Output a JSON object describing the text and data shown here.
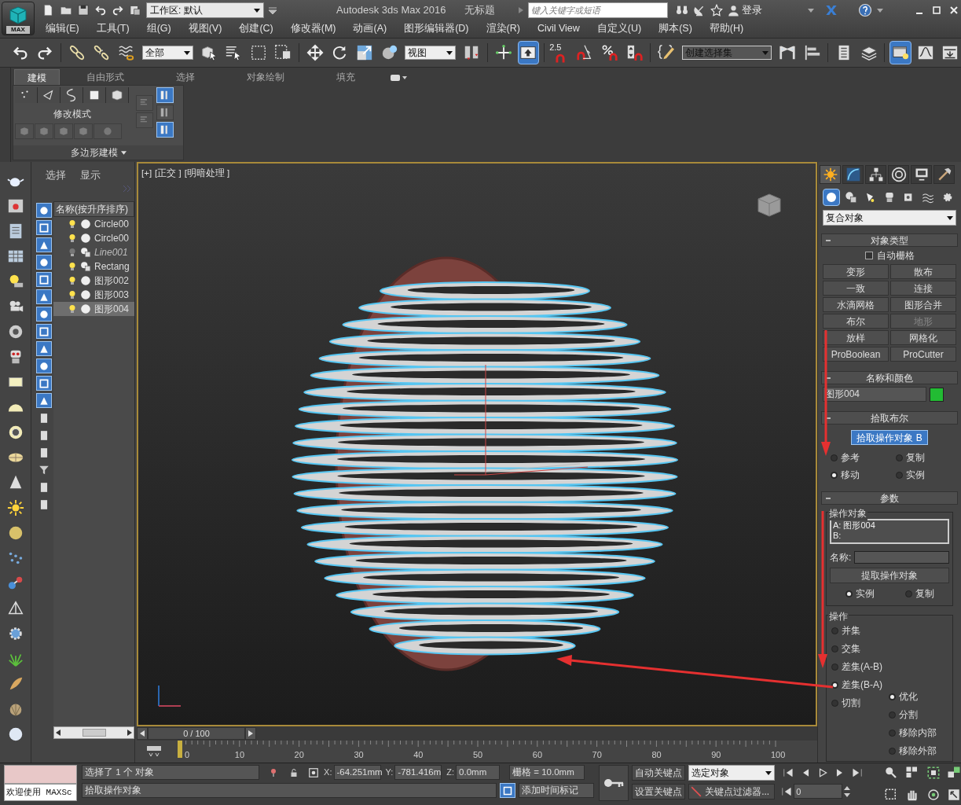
{
  "title_bar": {
    "app_button": "MAX",
    "workspace": "工作区: 默认",
    "app_name": "Autodesk 3ds Max 2016",
    "document": "无标题",
    "search": {
      "placeholder": "键入关键字或短语"
    },
    "sign_in": "登录"
  },
  "menu": [
    "编辑(E)",
    "工具(T)",
    "组(G)",
    "视图(V)",
    "创建(C)",
    "修改器(M)",
    "动画(A)",
    "图形编辑器(D)",
    "渲染(R)",
    "Civil View",
    "自定义(U)",
    "脚本(S)",
    "帮助(H)"
  ],
  "toolbar": [
    {
      "kind": "button",
      "active": false
    },
    {
      "kind": "button",
      "active": false
    },
    {
      "kind": "sep"
    },
    {
      "kind": "button",
      "active": false
    },
    {
      "kind": "button",
      "active": false
    },
    {
      "kind": "button",
      "active": false
    },
    {
      "kind": "dropdown",
      "value": "全部"
    },
    {
      "kind": "button",
      "active": false
    },
    {
      "kind": "button",
      "active": false
    },
    {
      "kind": "button",
      "active": false
    },
    {
      "kind": "button",
      "active": false
    },
    {
      "kind": "sep"
    },
    {
      "kind": "button",
      "active": false
    },
    {
      "kind": "button",
      "active": false
    },
    {
      "kind": "button",
      "active": false
    },
    {
      "kind": "button",
      "active": false
    },
    {
      "kind": "dropdown",
      "value": "视图"
    },
    {
      "kind": "button",
      "active": false
    },
    {
      "kind": "sep"
    },
    {
      "kind": "button",
      "active": false
    },
    {
      "kind": "button",
      "active": true
    },
    {
      "kind": "sep"
    },
    {
      "kind": "snap",
      "label": "2.5",
      "active": false
    },
    {
      "kind": "button",
      "active": false
    },
    {
      "kind": "button",
      "active": false
    },
    {
      "kind": "button",
      "active": false
    },
    {
      "kind": "sep"
    },
    {
      "kind": "button",
      "active": false
    },
    {
      "kind": "dropdown",
      "value": "创建选择集"
    },
    {
      "kind": "button",
      "active": false
    },
    {
      "kind": "button",
      "active": false
    },
    {
      "kind": "sep"
    },
    {
      "kind": "button",
      "active": false
    },
    {
      "kind": "button",
      "active": false
    },
    {
      "kind": "sep"
    },
    {
      "kind": "button",
      "active": true
    },
    {
      "kind": "button",
      "active": false
    },
    {
      "kind": "button",
      "active": false
    }
  ],
  "ribbon": {
    "tabs": [
      {
        "label": "建模",
        "selected": true
      },
      {
        "label": "自由形式",
        "selected": false
      },
      {
        "label": "选择",
        "selected": false
      },
      {
        "label": "对象绘制",
        "selected": false
      },
      {
        "label": "填充",
        "selected": false
      }
    ],
    "panel_label": "修改模式",
    "footer": "多边形建模",
    "side_buttons": [
      {
        "active": true
      },
      {
        "active": false
      },
      {
        "active": true
      }
    ]
  },
  "scene_explorer": {
    "tabs": [
      "选择",
      "显示"
    ],
    "column": "名称(按升序排序)",
    "rows": [
      {
        "name": "Circle00",
        "hidden": false,
        "selected": false
      },
      {
        "name": "Circle00",
        "hidden": false,
        "selected": false
      },
      {
        "name": "Line001",
        "hidden": true,
        "selected": false
      },
      {
        "name": "Rectang",
        "hidden": false,
        "selected": false
      },
      {
        "name": "图形002",
        "hidden": false,
        "selected": false
      },
      {
        "name": "图形003",
        "hidden": false,
        "selected": false
      },
      {
        "name": "图形004",
        "hidden": false,
        "selected": true
      }
    ]
  },
  "viewport": {
    "labels": [
      "[+]",
      "[正交 ]",
      "[明暗处理 ]"
    ]
  },
  "command_panel": {
    "tabs": [
      {
        "selected": true
      },
      {
        "selected": false
      },
      {
        "selected": false
      },
      {
        "selected": false
      },
      {
        "selected": false
      },
      {
        "selected": false
      }
    ],
    "categories": [
      {
        "selected": true
      },
      {
        "selected": false
      },
      {
        "selected": false
      },
      {
        "selected": false
      },
      {
        "selected": false
      },
      {
        "selected": false
      },
      {
        "selected": false
      }
    ],
    "category": "复合对象",
    "object_type": {
      "title": "对象类型",
      "auto_grid": {
        "label": "自动栅格",
        "checked": false
      },
      "buttons": [
        {
          "label": "变形",
          "disabled": false
        },
        {
          "label": "散布",
          "disabled": false
        },
        {
          "label": "一致",
          "disabled": false
        },
        {
          "label": "连接",
          "disabled": false
        },
        {
          "label": "水滴网格",
          "disabled": false
        },
        {
          "label": "图形合并",
          "disabled": false
        },
        {
          "label": "布尔",
          "disabled": false
        },
        {
          "label": "地形",
          "disabled": true
        },
        {
          "label": "放样",
          "disabled": false
        },
        {
          "label": "网格化",
          "disabled": false
        },
        {
          "label": "ProBoolean",
          "disabled": false
        },
        {
          "label": "ProCutter",
          "disabled": false
        }
      ]
    },
    "name_color": {
      "title": "名称和颜色",
      "name": "图形004",
      "color": "#22bb33"
    },
    "pick_boolean": {
      "title": "拾取布尔",
      "button": {
        "label": "拾取操作对象 B",
        "active": true
      },
      "options": [
        {
          "label": "参考",
          "selected": false
        },
        {
          "label": "复制",
          "selected": false
        },
        {
          "label": "移动",
          "selected": true
        },
        {
          "label": "实例",
          "selected": false
        }
      ]
    },
    "parameters": {
      "title": "参数",
      "operands_title": "操作对象",
      "operands": [
        "A: 图形004",
        "B:"
      ],
      "name_label": "名称:",
      "extract_button": "提取操作对象",
      "extract_mode": [
        {
          "label": "实例",
          "selected": true
        },
        {
          "label": "复制",
          "selected": false
        }
      ],
      "operation_title": "操作",
      "operations": [
        {
          "label": "并集",
          "selected": false
        },
        {
          "label": "交集",
          "selected": false
        },
        {
          "label": "差集(A-B)",
          "selected": false
        },
        {
          "label": "差集(B-A)",
          "selected": true
        },
        {
          "label": "切割",
          "selected": false
        }
      ],
      "cut_options": [
        {
          "label": "优化",
          "selected": true
        },
        {
          "label": "分割",
          "selected": false
        },
        {
          "label": "移除内部",
          "selected": false
        },
        {
          "label": "移除外部",
          "selected": false
        }
      ]
    }
  },
  "timeline": {
    "position": "0 / 100",
    "ruler": [
      "0",
      "10",
      "20",
      "30",
      "40",
      "50",
      "60",
      "70",
      "80",
      "90",
      "100"
    ]
  },
  "status": {
    "maxscript": "欢迎使用 MAXSc",
    "selection": "选择了 1 个 对象",
    "prompt": "拾取操作对象",
    "x_label": "X:",
    "x": "-64.251mm",
    "y_label": "Y:",
    "y": "-781.416m",
    "z_label": "Z:",
    "z": "0.0mm",
    "grid": "栅格 = 10.0mm",
    "add_time_tag": "添加时间标记",
    "auto_key": "自动关键点",
    "set_key": "设置关键点",
    "key_mode": "选定对象",
    "key_filters": "关键点过滤器...",
    "frame": "0"
  }
}
